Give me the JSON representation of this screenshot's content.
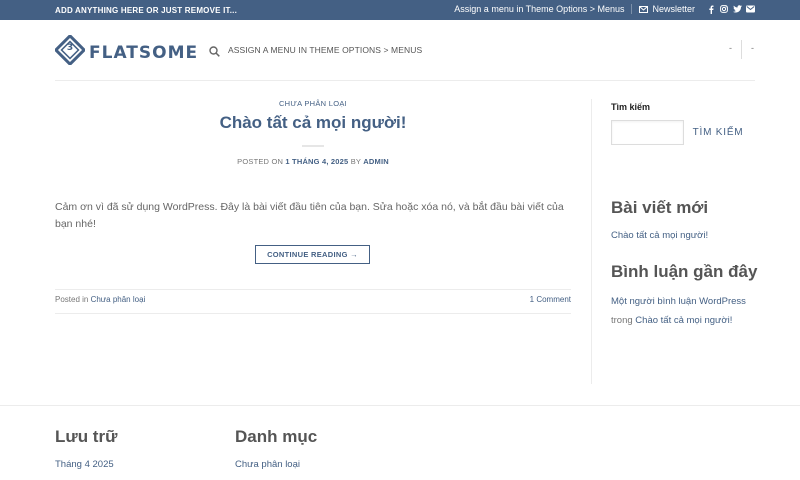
{
  "topbar": {
    "notice": "ADD ANYTHING HERE OR JUST REMOVE IT...",
    "menu_hint": "Assign a menu in Theme Options > Menus",
    "newsletter": "Newsletter",
    "social_icons": [
      "facebook-icon",
      "instagram-icon",
      "twitter-icon",
      "email-icon"
    ]
  },
  "header": {
    "logo_text": "FLATSOME",
    "logo_badge": "3",
    "menu_hint": "ASSIGN A MENU IN THEME OPTIONS > MENUS",
    "account_dash": "-",
    "cart_dash": "-"
  },
  "post": {
    "category": "CHƯA PHÂN LOẠI",
    "title": "Chào tất cả mọi người!",
    "meta_prefix": "POSTED ON ",
    "meta_date": "1 THÁNG 4, 2025",
    "meta_by": " BY ",
    "meta_author": "ADMIN",
    "excerpt": "Cảm ơn vì đã sử dụng WordPress. Đây là bài viết đầu tiên của bạn. Sửa hoặc xóa nó, và bắt đầu bài viết của bạn nhé!",
    "continue_label": "CONTINUE READING →",
    "posted_in_prefix": "Posted in ",
    "posted_in_cat": "Chưa phân loại",
    "comments": "1 Comment"
  },
  "sidebar": {
    "search_label": "Tìm kiếm",
    "search_button": "TÌM KIẾM",
    "recent_posts_heading": "Bài viết mới",
    "recent_post": "Chào tất cả mọi người!",
    "recent_comments_heading": "Bình luận gần đây",
    "comment_author": "Một người bình luận WordPress",
    "comment_on": " trong ",
    "comment_post": "Chào tất cả mọi người!"
  },
  "footer": {
    "archives_heading": "Lưu trữ",
    "archive_item": "Tháng 4 2025",
    "categories_heading": "Danh mục",
    "category_item": "Chưa phân loại"
  },
  "colors": {
    "primary": "#446084",
    "text": "#555555"
  }
}
